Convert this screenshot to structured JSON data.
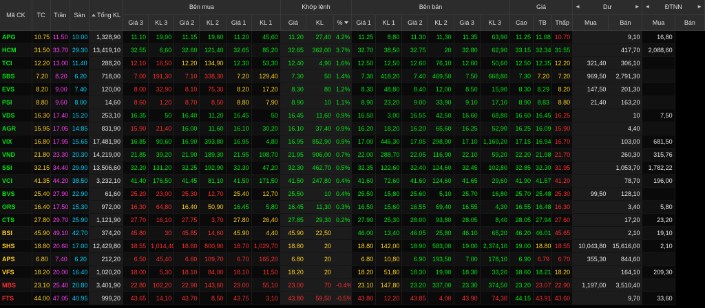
{
  "header": {
    "symbol": "Mã CK",
    "ref": "TC",
    "ceil": "Trần",
    "floor": "Sàn",
    "total_vol": "Tổng KL",
    "bid_group": "Bên mua",
    "match_group": "Khớp lệnh",
    "ask_group": "Bên bán",
    "price_group": "Giá",
    "remain_group": "Dư",
    "foreign_group": "ĐTNN",
    "bid_cols": [
      "Giá 3",
      "KL 3",
      "Giá 2",
      "KL 2",
      "Giá 1",
      "KL 1"
    ],
    "match_cols": [
      "Giá",
      "KL",
      "%"
    ],
    "ask_cols": [
      "Giá 1",
      "KL 1",
      "Giá 2",
      "KL 2",
      "Giá 3",
      "KL 3"
    ],
    "price_cols": [
      "Cao",
      "TB",
      "Thấp"
    ],
    "remain_cols": [
      "Mua",
      "Bán"
    ],
    "foreign_cols": [
      "Mua",
      "Bán"
    ],
    "left_arrow": "◄",
    "right_arrow": "►"
  },
  "colors": {
    "up": "#00e813",
    "down": "#ff2d2d",
    "ref": "#ffd21e",
    "ceil": "#ff3df8",
    "floor": "#00d4ff"
  },
  "rows": [
    {
      "v": [
        "APG",
        "10.75",
        "11.50",
        "10.00",
        "1,328,90",
        "11.10",
        "19,00",
        "11.15",
        "19,60",
        "11.20",
        "45,60",
        "11.20",
        "27,40",
        "4.2%",
        "11.25",
        "8,80",
        "11.30",
        "11,30",
        "11.35",
        "63,90",
        "11.25",
        "11.08",
        "10.70",
        "",
        "9,10",
        "16,80"
      ],
      "c": "gyrcwgggggggggggggggggggrgrww"
    },
    {
      "v": [
        "HCM",
        "31.50",
        "33.70",
        "29.30",
        "13,419,10",
        "32.55",
        "6,60",
        "32.60",
        "121,40",
        "32.65",
        "85,20",
        "32.65",
        "362,00",
        "3.7%",
        "32.70",
        "38,50",
        "32.75",
        "20",
        "32.80",
        "62,90",
        "33.15",
        "32.34",
        "31.55",
        "",
        "417,70",
        "2,088,60"
      ],
      "c": "gyrcwggggggggggggggggggggww"
    },
    {
      "v": [
        "TCI",
        "12.20",
        "13.00",
        "11.40",
        "288,20",
        "12.10",
        "16,50",
        "12.20",
        "134,90",
        "12.30",
        "53,30",
        "12.40",
        "4,90",
        "1.6%",
        "12.50",
        "12,50",
        "12.60",
        "76,10",
        "12.60",
        "50,60",
        "12.50",
        "12.35",
        "12.20",
        "321,40",
        "306,10",
        ""
      ],
      "c": "gyrcwrryyggggggggggggggyww"
    },
    {
      "v": [
        "SBS",
        "7.20",
        "8.20",
        "6.20",
        "718,00",
        "7.00",
        "191,30",
        "7.10",
        "338,30",
        "7.20",
        "129,40",
        "7.30",
        "50",
        "1.4%",
        "7.30",
        "418,20",
        "7.40",
        "469,50",
        "7.50",
        "668,80",
        "7.30",
        "7.20",
        "7.20",
        "969,50",
        "2,791,30",
        ""
      ],
      "c": "gyrcwrrrryygggggggggggyyww"
    },
    {
      "v": [
        "EVS",
        "8.20",
        "9.00",
        "7.40",
        "120,00",
        "8.00",
        "32,90",
        "8.10",
        "75,30",
        "8.20",
        "17,20",
        "8.30",
        "80",
        "1.2%",
        "8.30",
        "48,80",
        "8.40",
        "12,00",
        "8.50",
        "15,90",
        "8.30",
        "8.29",
        "8.20",
        "147,50",
        "201,30",
        ""
      ],
      "c": "gyrcwrrrryygggggggggggyyww"
    },
    {
      "v": [
        "PSI",
        "8.80",
        "9.60",
        "8.00",
        "14,60",
        "8.60",
        "1,20",
        "8.70",
        "8,50",
        "8.80",
        "7,90",
        "8.90",
        "10",
        "1.1%",
        "8.90",
        "23,20",
        "9.00",
        "33,90",
        "9.10",
        "17,10",
        "8.90",
        "8.83",
        "8.80",
        "21,40",
        "163,20",
        ""
      ],
      "c": "gyrcwrrrryygggggggggggyyww"
    },
    {
      "v": [
        "VDS",
        "16.30",
        "17.40",
        "15.20",
        "253,10",
        "16.35",
        "50",
        "16.40",
        "11,20",
        "16.45",
        "50",
        "16.45",
        "11,60",
        "0.9%",
        "16.50",
        "3,00",
        "16.55",
        "42,50",
        "16.60",
        "68,80",
        "16.60",
        "16.45",
        "16.25",
        "",
        "10",
        "7,50"
      ],
      "c": "gyrcwgggggggggggggggggggrrww"
    },
    {
      "v": [
        "AGR",
        "15.95",
        "17.05",
        "14.85",
        "831,90",
        "15.90",
        "21,40",
        "16.00",
        "11,60",
        "16.10",
        "30,20",
        "16.10",
        "37,40",
        "0.9%",
        "16.20",
        "18,20",
        "16.20",
        "65,60",
        "16.25",
        "52,90",
        "16.25",
        "16.09",
        "15.90",
        "",
        "4,40",
        ""
      ],
      "c": "gyrcwrrgggggggggggggggggrww"
    },
    {
      "v": [
        "VIX",
        "16.80",
        "17.95",
        "15.65",
        "17,481,90",
        "16.85",
        "90,60",
        "16.90",
        "393,80",
        "16.95",
        "4,80",
        "16.95",
        "852,90",
        "0.9%",
        "17.00",
        "446,30",
        "17.05",
        "298,90",
        "17.10",
        "1,169,20",
        "17.15",
        "16.94",
        "16.70",
        "",
        "103,00",
        "681,50"
      ],
      "c": "gyrcwgggggggggggggggggggrww"
    },
    {
      "v": [
        "VND",
        "21.80",
        "23.30",
        "20.30",
        "14,219,00",
        "21.85",
        "39,20",
        "21.90",
        "189,30",
        "21.95",
        "108,70",
        "21.95",
        "906,00",
        "0.7%",
        "22.00",
        "288,70",
        "22.05",
        "116,90",
        "22.10",
        "59,20",
        "22.20",
        "21.98",
        "21.70",
        "",
        "260,30",
        "315,76"
      ],
      "c": "gyrcwgggggggggggggggggggrww"
    },
    {
      "v": [
        "SSI",
        "32.15",
        "34.40",
        "29.90",
        "13,506,60",
        "32.20",
        "131,20",
        "32.25",
        "192,90",
        "32.30",
        "47,20",
        "32.30",
        "462,70",
        "0.5%",
        "32.35",
        "122,60",
        "32.40",
        "124,60",
        "32.45",
        "102,80",
        "32.85",
        "32.30",
        "31.95",
        "",
        "1,053,70",
        "1,782,22"
      ],
      "c": "gyrcwgggggggggggggggggggrww"
    },
    {
      "v": [
        "VCI",
        "41.35",
        "44.20",
        "38.50",
        "3,232,10",
        "41.40",
        "176,50",
        "41.45",
        "81,10",
        "41.50",
        "171,50",
        "41.50",
        "247,80",
        "0.4%",
        "41.60",
        "72,60",
        "41.60",
        "124,60",
        "41.65",
        "29,60",
        "41.90",
        "41.57",
        "41.20",
        "",
        "78,70",
        "196,00"
      ],
      "c": "gyrcwgggggggggggggggggggrww"
    },
    {
      "v": [
        "BVS",
        "25.40",
        "27.90",
        "22.90",
        "61,60",
        "25.20",
        "23,00",
        "25.30",
        "12,70",
        "25.40",
        "12,70",
        "25.50",
        "10",
        "0.4%",
        "25.50",
        "15,80",
        "25.60",
        "5,10",
        "25.70",
        "16,80",
        "25.70",
        "25.48",
        "25.30",
        "99,50",
        "128,10",
        ""
      ],
      "c": "gyrcwrrrryygggggggggggggrww"
    },
    {
      "v": [
        "ORS",
        "16.40",
        "17.50",
        "15.30",
        "972,00",
        "16.30",
        "64,80",
        "16.40",
        "50,90",
        "16.45",
        "5,80",
        "16.45",
        "11,30",
        "0.3%",
        "16.50",
        "15,60",
        "16.55",
        "69,40",
        "16.55",
        "4,30",
        "16.55",
        "16.48",
        "16.30",
        "",
        "3,40",
        "5,80"
      ],
      "c": "gyrcwrryyggggggggggggggrww"
    },
    {
      "v": [
        "CTS",
        "27.80",
        "29.70",
        "25.90",
        "1,121,90",
        "27.70",
        "16,10",
        "27.75",
        "3,70",
        "27.80",
        "26,40",
        "27.85",
        "29,30",
        "0.2%",
        "27.90",
        "25,30",
        "28.00",
        "93,80",
        "28.05",
        "8,40",
        "28.05",
        "27.94",
        "27.60",
        "",
        "17,20",
        "23,20"
      ],
      "c": "gyrcwrrrryygggggggggggggrww"
    },
    {
      "v": [
        "BSI",
        "45.90",
        "49.10",
        "42.70",
        "374,20",
        "45.80",
        "30",
        "45.85",
        "14,60",
        "45.90",
        "4,40",
        "45.90",
        "22,50",
        "",
        "46.00",
        "13,40",
        "46.05",
        "25,80",
        "46.10",
        "65,20",
        "46.20",
        "46.01",
        "45.65",
        "",
        "2,10",
        "19,10"
      ],
      "c": "gyrcwrryyyyyyggggggggggrww"
    },
    {
      "v": [
        "SHS",
        "18.80",
        "20.60",
        "17.00",
        "12,429,80",
        "18.55",
        "1,014,40",
        "18.60",
        "800,90",
        "18.70",
        "1,029,70",
        "18.80",
        "20",
        "",
        "18.80",
        "142,00",
        "18.90",
        "583,00",
        "19.00",
        "2,374,10",
        "19.00",
        "18.80",
        "18.55",
        "10,043,80",
        "15,616,00",
        "2,10"
      ],
      "c": "gyrcwrrrrrryyyyygggggggggwww"
    },
    {
      "v": [
        "APS",
        "6.80",
        "7.40",
        "6.20",
        "212,20",
        "6.50",
        "45,40",
        "6.60",
        "109,70",
        "6.70",
        "165,20",
        "6.80",
        "20",
        "",
        "6.80",
        "10,80",
        "6.90",
        "193,50",
        "7.00",
        "178,10",
        "6.90",
        "6.79",
        "6.70",
        "355,30",
        "844,60",
        ""
      ],
      "c": "gyrcwrrrrrryyyyygggggggrrww"
    },
    {
      "v": [
        "VFS",
        "18.20",
        "20.00",
        "16.40",
        "1,020,20",
        "18.00",
        "5,30",
        "18.10",
        "84,00",
        "18.10",
        "11,50",
        "18.20",
        "20",
        "",
        "18.20",
        "51,80",
        "18.30",
        "19,90",
        "18.30",
        "33,20",
        "18.60",
        "18.21",
        "18.20",
        "",
        "164,10",
        "209,30"
      ],
      "c": "gyrcwrrrrrryyyyygggggggyww"
    },
    {
      "v": [
        "MBS",
        "23.10",
        "25.40",
        "20.80",
        "3,401,90",
        "22.80",
        "102,20",
        "22.90",
        "143,60",
        "23.00",
        "55,10",
        "23.00",
        "70",
        "-0.4%",
        "23.10",
        "147,80",
        "23.20",
        "337,00",
        "23.30",
        "374,50",
        "23.20",
        "23.07",
        "22.90",
        "1,197,00",
        "3,510,40",
        ""
      ],
      "c": "gyrcwrrrrrrrrrrrgggggggrrww"
    },
    {
      "v": [
        "FTS",
        "44.00",
        "47.05",
        "40.95",
        "999,20",
        "43.65",
        "14,10",
        "43.70",
        "8,50",
        "43.75",
        "3,10",
        "43.80",
        "59,50",
        "-0.5%",
        "43.80",
        "12,20",
        "43.85",
        "4,00",
        "43.90",
        "74,30",
        "44.15",
        "43.91",
        "43.60",
        "",
        "9,70",
        "33,60"
      ],
      "c": "gyrcwrrrrrrrrrrrrrrrrrrgrrww"
    }
  ]
}
